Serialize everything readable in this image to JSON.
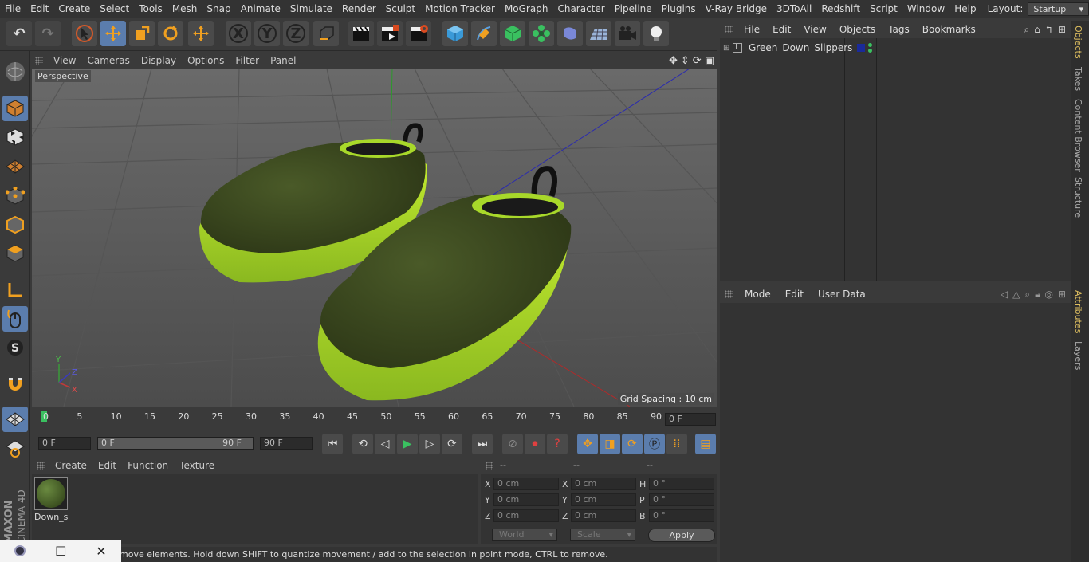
{
  "menubar": {
    "items": [
      "File",
      "Edit",
      "Create",
      "Select",
      "Tools",
      "Mesh",
      "Snap",
      "Animate",
      "Simulate",
      "Render",
      "Sculpt",
      "Motion Tracker",
      "MoGraph",
      "Character",
      "Pipeline",
      "Plugins",
      "V-Ray Bridge",
      "3DToAll",
      "Redshift",
      "Script",
      "Window",
      "Help"
    ],
    "layout_label": "Layout:",
    "layout_value": "Startup"
  },
  "toolbar": {
    "axis_x": "X",
    "axis_y": "Y",
    "axis_z": "Z"
  },
  "viewport": {
    "menu": [
      "View",
      "Cameras",
      "Display",
      "Options",
      "Filter",
      "Panel"
    ],
    "label": "Perspective",
    "grid_spacing": "Grid Spacing : 10 cm",
    "axis_x": "X",
    "axis_y": "Y",
    "axis_z": "Z"
  },
  "timeline": {
    "ticks": [
      "0",
      "5",
      "10",
      "15",
      "20",
      "25",
      "30",
      "35",
      "40",
      "45",
      "50",
      "55",
      "60",
      "65",
      "70",
      "75",
      "80",
      "85",
      "90"
    ],
    "current_frame": "0 F"
  },
  "transport": {
    "start_field": "0 F",
    "range_start": "0 F",
    "range_end": "90 F",
    "end_field": "90 F"
  },
  "material_panel": {
    "menu": [
      "Create",
      "Edit",
      "Function",
      "Texture"
    ],
    "material_name": "Down_s"
  },
  "coord_panel": {
    "headers": [
      "--",
      "--",
      "--"
    ],
    "rows": [
      {
        "l1": "X",
        "v1": "0 cm",
        "l2": "X",
        "v2": "0 cm",
        "l3": "H",
        "v3": "0 °"
      },
      {
        "l1": "Y",
        "v1": "0 cm",
        "l2": "Y",
        "v2": "0 cm",
        "l3": "P",
        "v3": "0 °"
      },
      {
        "l1": "Z",
        "v1": "0 cm",
        "l2": "Z",
        "v2": "0 cm",
        "l3": "B",
        "v3": "0 °"
      }
    ],
    "world": "World",
    "scale": "Scale",
    "apply": "Apply"
  },
  "status": "move elements. Hold down SHIFT to quantize movement / add to the selection in point mode, CTRL to remove.",
  "object_panel": {
    "menu": [
      "File",
      "Edit",
      "View",
      "Objects",
      "Tags",
      "Bookmarks"
    ],
    "object_name": "Green_Down_Slippers"
  },
  "attr_panel": {
    "menu": [
      "Mode",
      "Edit",
      "User Data"
    ]
  },
  "side_tabs": {
    "top": [
      "Objects",
      "Takes",
      "Content Browser",
      "Structure"
    ],
    "bottom": [
      "Attributes",
      "Layers"
    ]
  },
  "branding": {
    "maxon": "MAXON",
    "product": "CINEMA 4D"
  },
  "colors": {
    "accent": "#5b7dad",
    "slipper_body": "#3d4a22",
    "slipper_sole": "#a8d42a"
  }
}
